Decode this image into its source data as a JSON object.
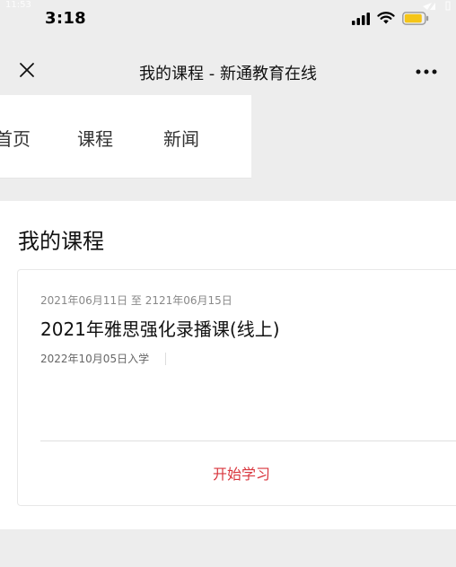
{
  "outer_status": {
    "time": "11:53"
  },
  "status_bar": {
    "time": "3:18"
  },
  "nav_bar": {
    "title": "我的课程 - 新通教育在线",
    "close_icon": "close-icon",
    "more_icon": "more-icon"
  },
  "site_nav": {
    "tabs": [
      {
        "label": "首页"
      },
      {
        "label": "课程"
      },
      {
        "label": "新闻"
      }
    ]
  },
  "main": {
    "section_title": "我的课程",
    "course": {
      "date_range": "2021年06月11日 至 2121年06月15日",
      "title": "2021年雅思强化录播课(线上)",
      "enroll_date": "2022年10月05日入学",
      "start_label": "开始学习"
    }
  },
  "colors": {
    "accent": "#d9363e",
    "background": "#ededed",
    "panel": "#ffffff"
  }
}
